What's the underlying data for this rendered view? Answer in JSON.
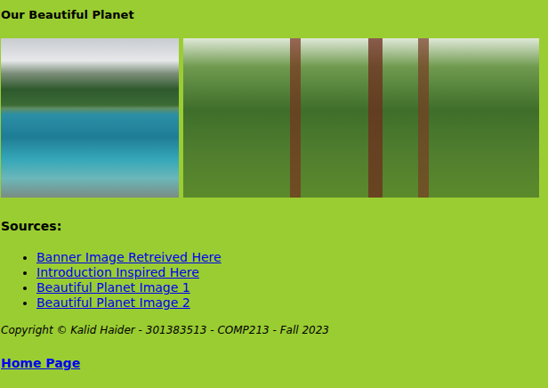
{
  "page": {
    "title": "Our Beautiful Planet"
  },
  "sources": {
    "heading": "Sources:",
    "links": [
      "Banner Image Retreived Here",
      "Introduction Inspired Here",
      "Beautiful Planet Image 1",
      "Beautiful Planet Image 2"
    ]
  },
  "footer": {
    "copyright": "Copyright © Kalid Haider - 301383513 - COMP213 - Fall 2023",
    "home_link": "Home Page"
  }
}
